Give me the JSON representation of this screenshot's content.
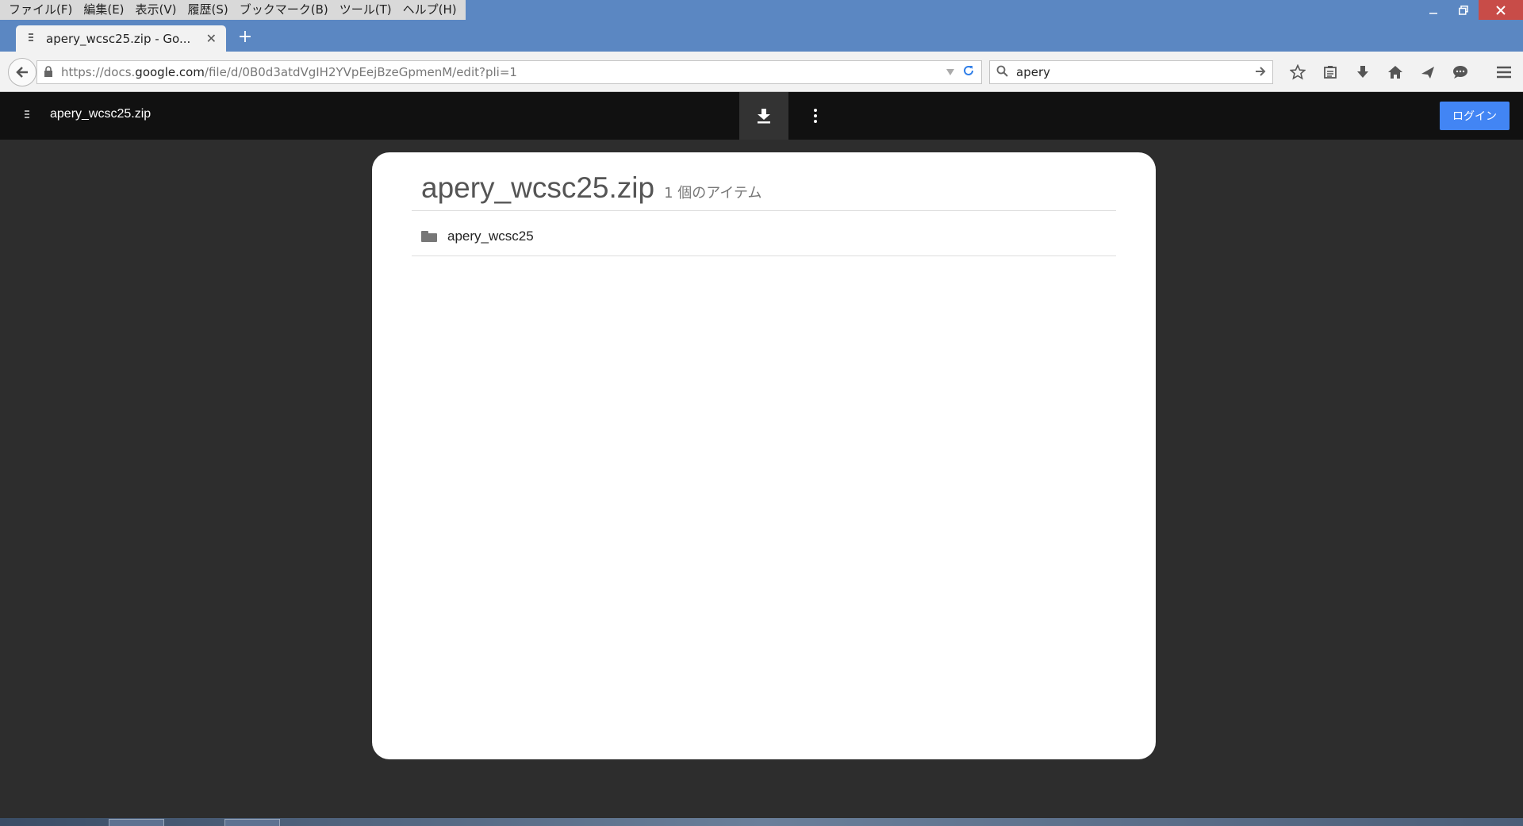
{
  "menu": {
    "items": [
      "ファイル(F)",
      "編集(E)",
      "表示(V)",
      "履歴(S)",
      "ブックマーク(B)",
      "ツール(T)",
      "ヘルプ(H)"
    ]
  },
  "window": {
    "minimize_icon": "minimize-icon",
    "restore_icon": "restore-icon",
    "close_icon": "close-icon"
  },
  "tab": {
    "title": "apery_wcsc25.zip - Go...",
    "close_glyph": "✕",
    "new_tab_glyph": "+"
  },
  "navbar": {
    "url_prefix": "https://docs.",
    "url_host": "google.com",
    "url_path": "/file/d/0B0d3atdVgIH2YVpEejBzeGpmenM/edit?pli=1",
    "search_value": "apery",
    "icons": [
      "star-icon",
      "reading-list-icon",
      "download-icon",
      "home-icon",
      "send-icon",
      "chat-icon"
    ]
  },
  "drive": {
    "file_title": "apery_wcsc25.zip",
    "login_label": "ログイン"
  },
  "card": {
    "title": "apery_wcsc25.zip",
    "count": "1 個のアイテム",
    "rows": [
      {
        "label": "apery_wcsc25",
        "icon": "folder-icon"
      }
    ]
  }
}
